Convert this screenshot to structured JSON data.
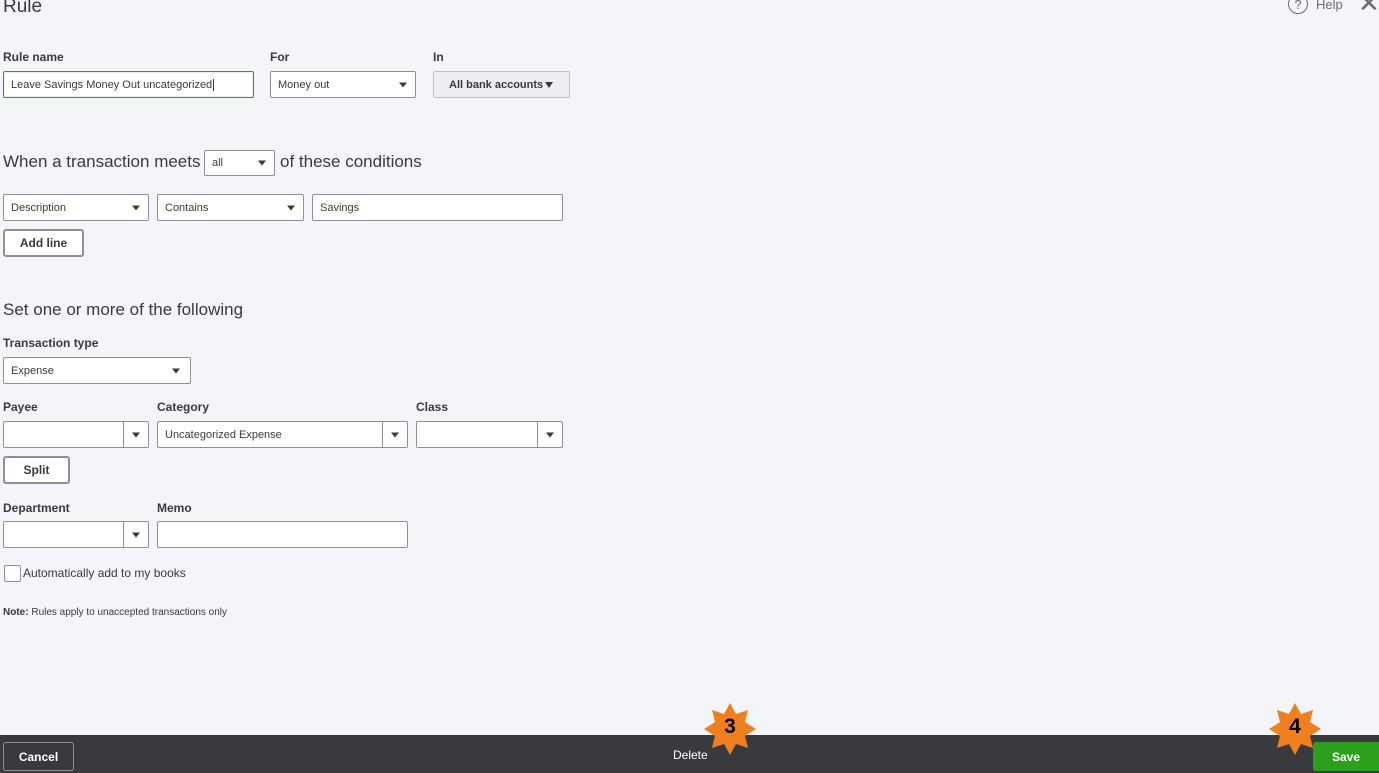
{
  "header": {
    "title": "Rule",
    "help_label": "Help",
    "help_symbol": "?",
    "close_symbol": "✕"
  },
  "rule_name": {
    "label": "Rule name",
    "value": "Leave Savings Money Out uncategorized"
  },
  "for_field": {
    "label": "For",
    "value": "Money out"
  },
  "in_field": {
    "label": "In",
    "value": "All bank accounts"
  },
  "conditions": {
    "prefix": "When a transaction meets",
    "match_value": "all",
    "suffix": "of these conditions",
    "rows": [
      {
        "field": "Description",
        "operator": "Contains",
        "value": "Savings"
      }
    ],
    "add_line_label": "Add line"
  },
  "actions": {
    "title": "Set one or more of the following",
    "transaction_type": {
      "label": "Transaction type",
      "value": "Expense"
    },
    "payee": {
      "label": "Payee",
      "value": ""
    },
    "category": {
      "label": "Category",
      "value": "Uncategorized Expense"
    },
    "class": {
      "label": "Class",
      "value": ""
    },
    "split_label": "Split",
    "department": {
      "label": "Department",
      "value": ""
    },
    "memo": {
      "label": "Memo",
      "value": ""
    }
  },
  "auto_add": {
    "label": "Automatically add to my books",
    "checked": false
  },
  "note": {
    "bold": "Note:",
    "text": " Rules apply to unaccepted transactions only"
  },
  "footer": {
    "cancel_label": "Cancel",
    "delete_label": "Delete",
    "save_label": "Save"
  },
  "callouts": [
    {
      "number": "3",
      "color": "#f07f1e"
    },
    {
      "number": "4",
      "color": "#f07f1e"
    }
  ],
  "colors": {
    "accent_green": "#2ca01c",
    "footer_bg": "#393a3d",
    "page_bg": "#f4f5f8"
  }
}
